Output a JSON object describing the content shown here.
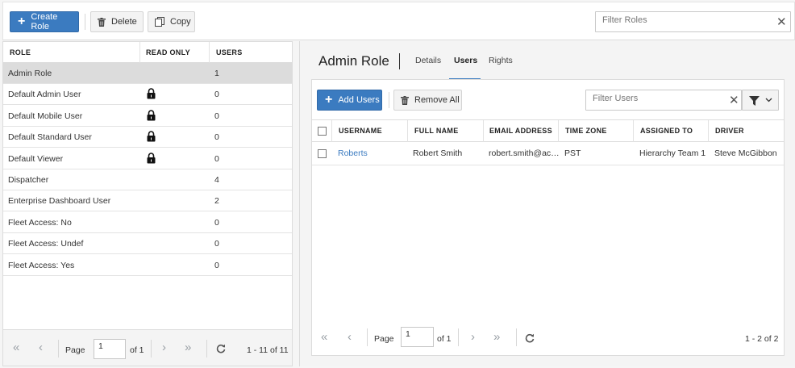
{
  "toolbar": {
    "create_role": "Create Role",
    "delete": "Delete",
    "copy": "Copy",
    "filter_placeholder": "Filter Roles"
  },
  "roles": {
    "columns": {
      "role": "ROLE",
      "read_only": "READ ONLY",
      "users": "USERS"
    },
    "rows": [
      {
        "name": "Admin Role",
        "read_only": false,
        "users": "1"
      },
      {
        "name": "Default Admin User",
        "read_only": true,
        "users": "0"
      },
      {
        "name": "Default Mobile User",
        "read_only": true,
        "users": "0"
      },
      {
        "name": "Default Standard User",
        "read_only": true,
        "users": "0"
      },
      {
        "name": "Default Viewer",
        "read_only": true,
        "users": "0"
      },
      {
        "name": "Dispatcher",
        "read_only": false,
        "users": "4"
      },
      {
        "name": "Enterprise Dashboard User",
        "read_only": false,
        "users": "2"
      },
      {
        "name": "Fleet Access: No",
        "read_only": false,
        "users": "0"
      },
      {
        "name": "Fleet Access: Undef",
        "read_only": false,
        "users": "0"
      },
      {
        "name": "Fleet Access: Yes",
        "read_only": false,
        "users": "0"
      }
    ],
    "pager": {
      "page_label": "Page",
      "page_value": "1",
      "of_label": "of 1",
      "range": "1 - 11 of 11"
    }
  },
  "detail": {
    "title": "Admin Role",
    "tabs": [
      "Details",
      "Users",
      "Rights"
    ],
    "active_tab": "Users",
    "add_users": "Add Users",
    "remove_all": "Remove All",
    "filter_placeholder": "Filter Users",
    "columns": [
      "USERNAME",
      "FULL NAME",
      "EMAIL ADDRESS",
      "TIME ZONE",
      "ASSIGNED TO",
      "DRIVER"
    ],
    "rows": [
      {
        "username": "Roberts",
        "full_name": "Robert Smith",
        "email": "robert.smith@ac…",
        "time_zone": "PST",
        "assigned_to": "Hierarchy Team 1",
        "driver": "Steve McGibbon"
      }
    ],
    "pager": {
      "page_label": "Page",
      "page_value": "1",
      "of_label": "of 1",
      "range": "1 - 2 of 2"
    }
  },
  "colors": {
    "accent": "#3b7bc0",
    "selected_row": "#dcdcdc"
  },
  "icons": {
    "lock": "lock-icon",
    "trash": "trash-icon",
    "copy": "copy-icon",
    "filter": "filter-icon",
    "refresh": "refresh-icon"
  }
}
